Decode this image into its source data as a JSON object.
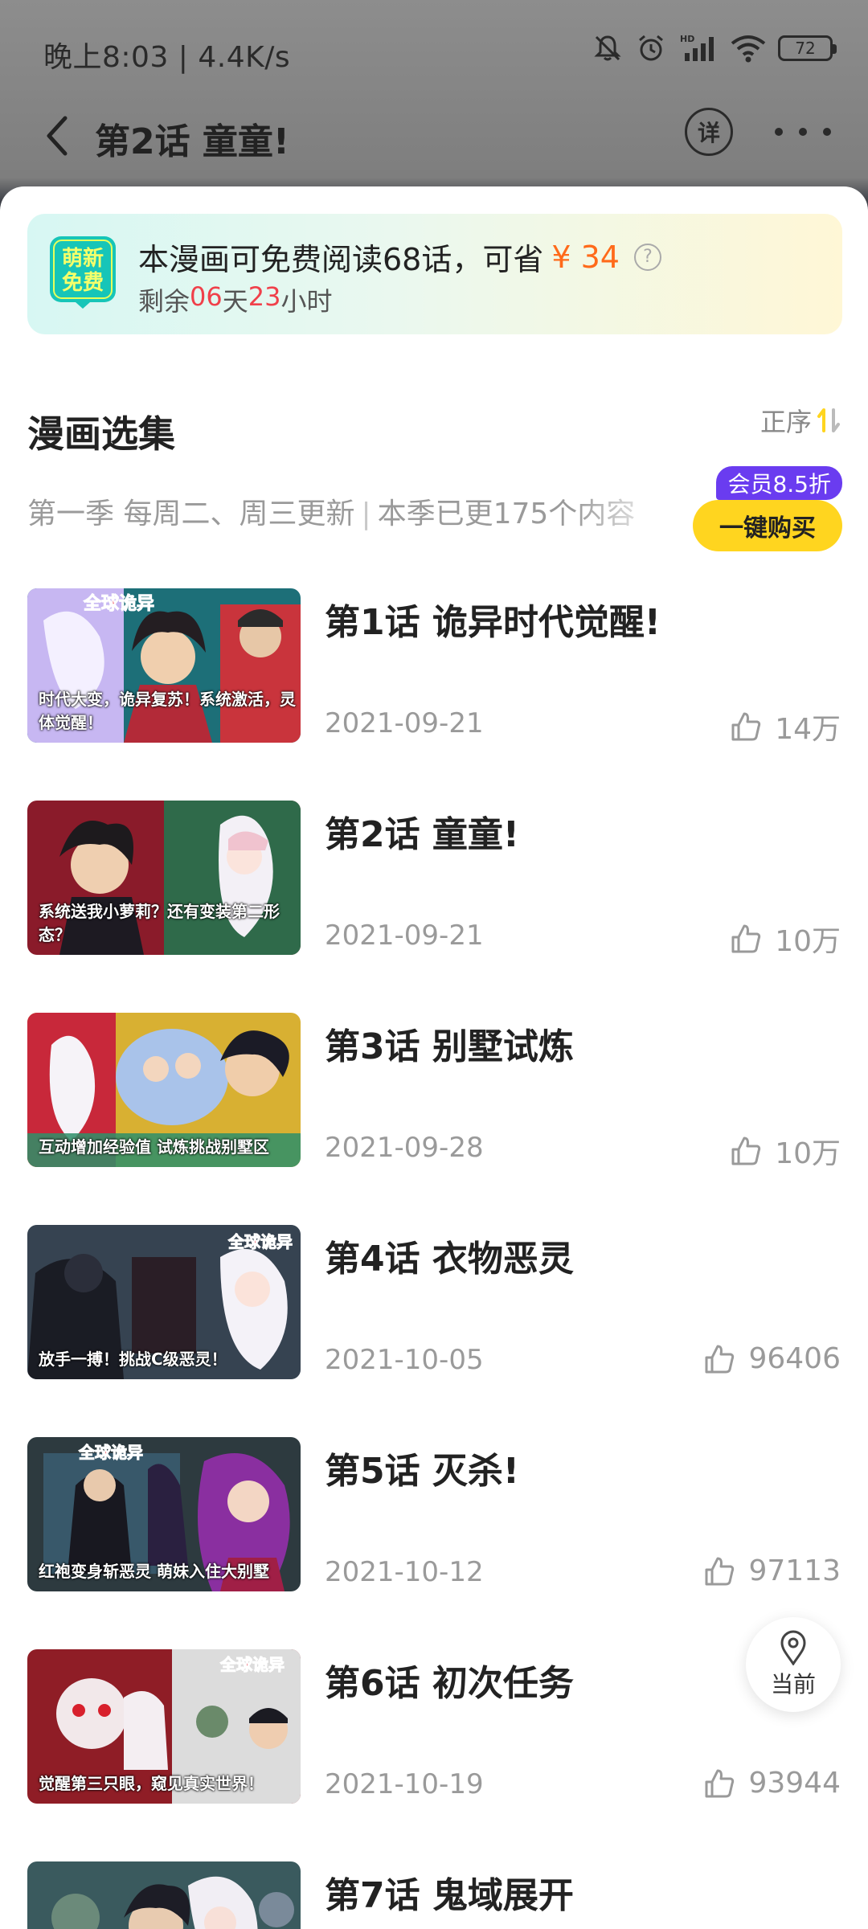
{
  "status_bar": {
    "time_speed": "晚上8:03 | 4.4K/s",
    "battery": "72"
  },
  "nav": {
    "title": "第2话 童童!",
    "detail_label": "详"
  },
  "promo": {
    "badge_text": "萌新免费",
    "main_text": "本漫画可免费阅读68话，可省",
    "price": "¥ 34",
    "help": "?",
    "remain_prefix": "剩余",
    "days": "06",
    "days_unit": "天",
    "hours": "23",
    "hours_unit": "小时"
  },
  "section": {
    "title": "漫画选集",
    "sort_label": "正序",
    "update_schedule": "第一季 每周二、周三更新",
    "update_sep": "|",
    "update_count": "本季已更175个内容",
    "buy_tag": "会员8.5折",
    "buy_label": "一键购买"
  },
  "episodes": [
    {
      "title": "第1话 诡异时代觉醒!",
      "date": "2021-09-21",
      "likes": "14万",
      "caption": "时代大变，诡异复苏！系统激活，灵体觉醒！"
    },
    {
      "title": "第2话 童童!",
      "date": "2021-09-21",
      "likes": "10万",
      "caption": "系统送我小萝莉？还有变装第二形态？"
    },
    {
      "title": "第3话 别墅试炼",
      "date": "2021-09-28",
      "likes": "10万",
      "caption": "互动增加经验值 试炼挑战别墅区"
    },
    {
      "title": "第4话 衣物恶灵",
      "date": "2021-10-05",
      "likes": "96406",
      "caption": "放手一搏！挑战C级恶灵！"
    },
    {
      "title": "第5话 灭杀!",
      "date": "2021-10-12",
      "likes": "97113",
      "caption": "红袍变身斩恶灵 萌妹入住大别墅"
    },
    {
      "title": "第6话 初次任务",
      "date": "2021-10-19",
      "likes": "93944",
      "caption": "觉醒第三只眼，窥见真实世界！"
    },
    {
      "title": "第7话 鬼域展开",
      "date": "",
      "likes": "",
      "caption": ""
    }
  ],
  "float_button": {
    "label": "当前"
  },
  "colors": {
    "accent_orange": "#ff6a1a",
    "countdown_red": "#f0404a",
    "buy_yellow": "#ffd51f",
    "vip_purple": "#6a3cf0"
  }
}
